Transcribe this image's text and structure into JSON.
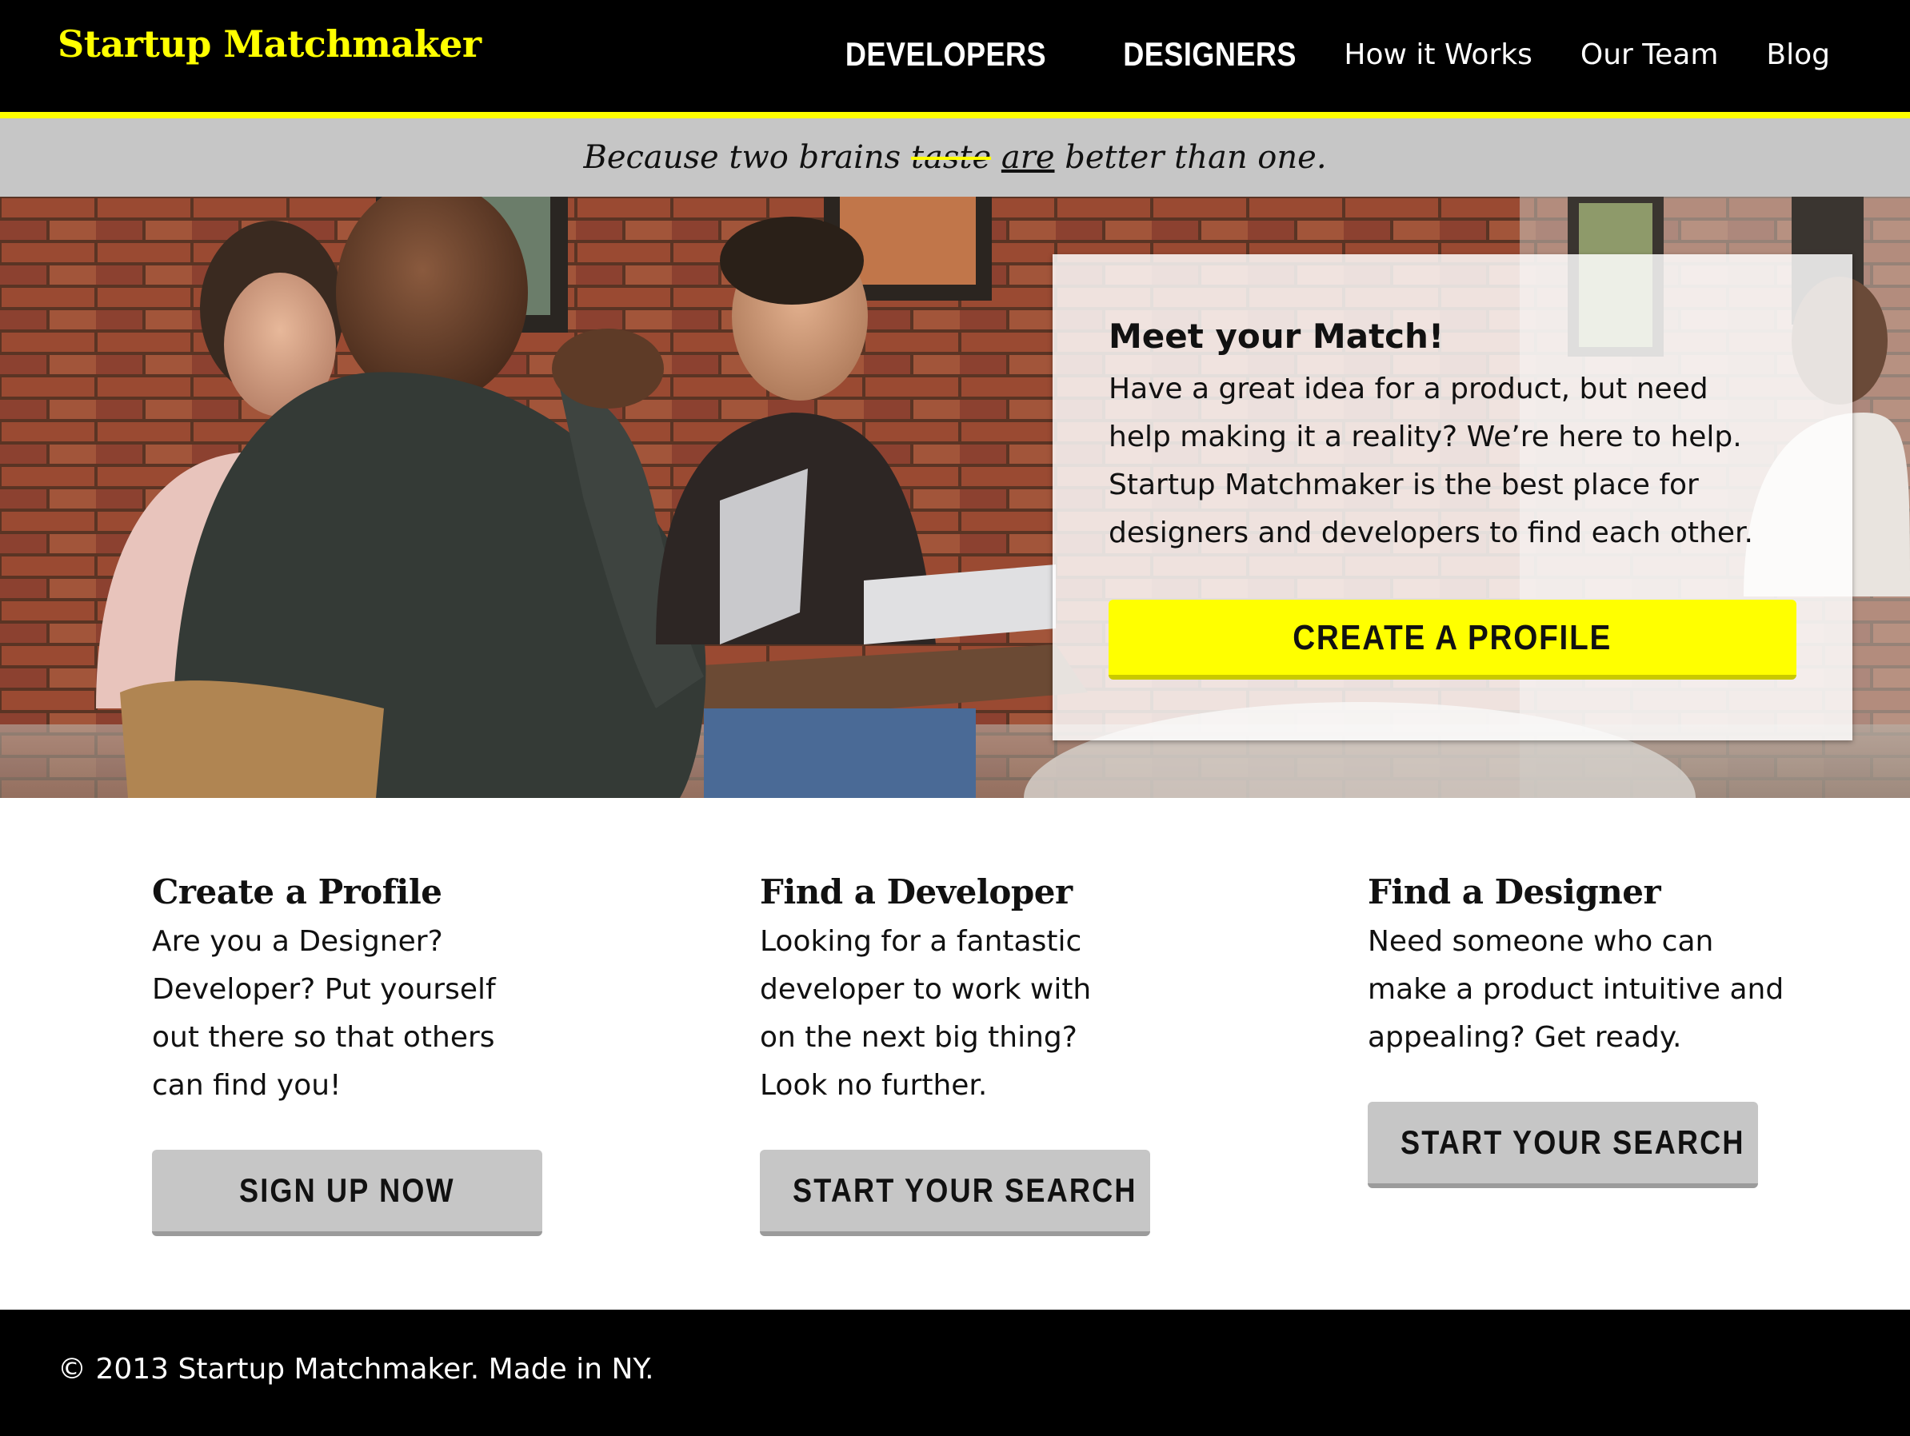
{
  "header": {
    "logo": "Startup Matchmaker",
    "nav": [
      {
        "label": "DEVELOPERS"
      },
      {
        "label": "DESIGNERS"
      },
      {
        "label": "How it Works"
      },
      {
        "label": "Our Team"
      },
      {
        "label": "Blog"
      }
    ]
  },
  "tagline": {
    "before": "Because two brains ",
    "struck": "taste",
    "underlined": "are",
    "after": " better than one."
  },
  "hero": {
    "title": "Meet your Match!",
    "text": "Have a great idea for a product, but need help making it a reality? We’re here to help. Startup Matchmaker is the best place for designers and developers to find each other.",
    "cta_label": "CREATE A PROFILE"
  },
  "features": [
    {
      "title": "Create a Profile",
      "text": "Are you a Designer? Developer? Put yourself out there so that others can find you!",
      "button": "SIGN UP NOW"
    },
    {
      "title": "Find a Developer",
      "text": "Looking for a fantastic developer to work with on the next big thing? Look no further.",
      "button": "START YOUR SEARCH"
    },
    {
      "title": "Find a Designer",
      "text": "Need someone who can make a product intuitive and appealing? Get ready.",
      "button": "START YOUR SEARCH"
    }
  ],
  "footer": {
    "copyright": "© 2013 Startup Matchmaker. Made in NY."
  },
  "colors": {
    "accent": "#ffff00",
    "header_bg": "#000000",
    "band_bg": "#c6c6c6",
    "button_grey": "#c6c6c6"
  }
}
